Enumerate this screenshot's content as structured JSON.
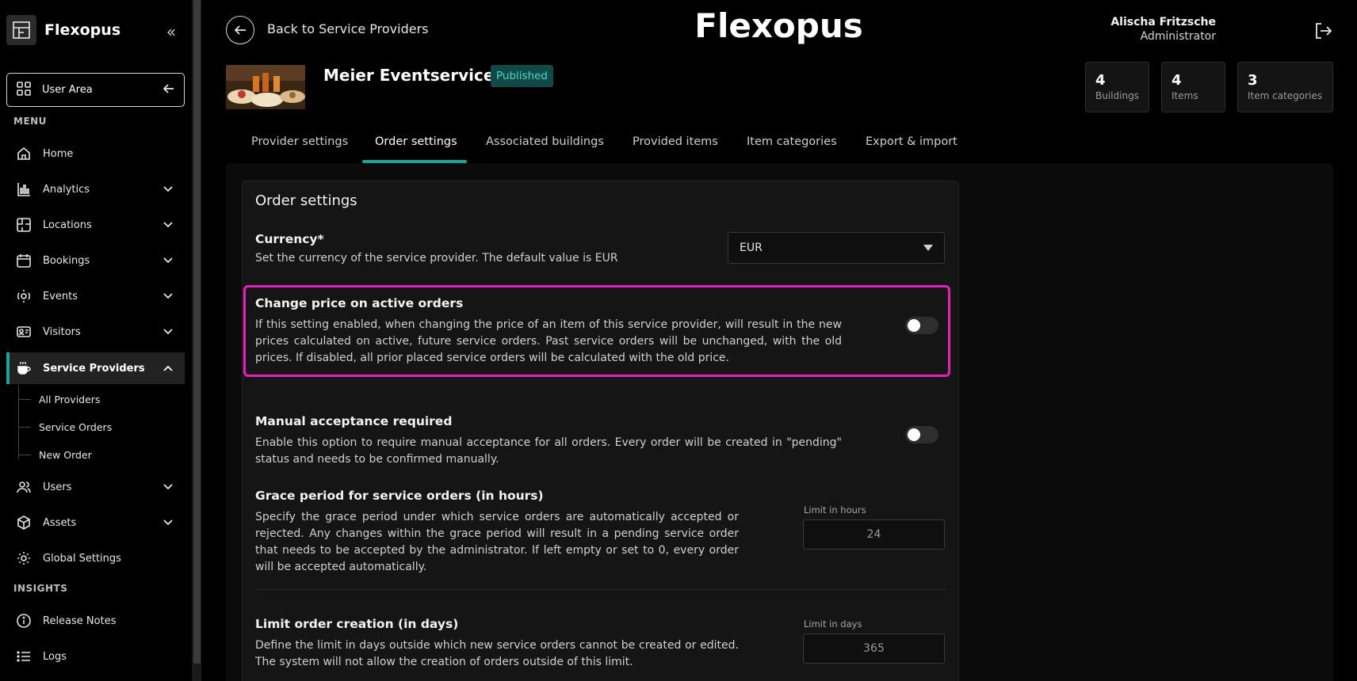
{
  "sidebar": {
    "brand": "Flexopus",
    "user_area": "User Area",
    "menu_label": "MENU",
    "insights_label": "INSIGHTS",
    "items": [
      {
        "label": "Home"
      },
      {
        "label": "Analytics"
      },
      {
        "label": "Locations"
      },
      {
        "label": "Bookings"
      },
      {
        "label": "Events"
      },
      {
        "label": "Visitors"
      },
      {
        "label": "Service Providers"
      },
      {
        "label": "Users"
      },
      {
        "label": "Assets"
      },
      {
        "label": "Global Settings"
      }
    ],
    "sub_items": [
      {
        "label": "All Providers"
      },
      {
        "label": "Service Orders"
      },
      {
        "label": "New Order"
      }
    ],
    "insights": [
      {
        "label": "Release Notes"
      },
      {
        "label": "Logs"
      }
    ]
  },
  "header": {
    "back_label": "Back to Service Providers",
    "title": "Flexopus",
    "user_name": "Alischa Fritzsche",
    "user_role": "Administrator"
  },
  "provider": {
    "name": "Meier Eventservice",
    "status": "Published",
    "stats": [
      {
        "value": "4",
        "label": "Buildings"
      },
      {
        "value": "4",
        "label": "Items"
      },
      {
        "value": "3",
        "label": "Item categories"
      }
    ]
  },
  "tabs": [
    {
      "label": "Provider settings"
    },
    {
      "label": "Order settings"
    },
    {
      "label": "Associated buildings"
    },
    {
      "label": "Provided items"
    },
    {
      "label": "Item categories"
    },
    {
      "label": "Export & import"
    }
  ],
  "order_settings": {
    "title": "Order settings",
    "currency": {
      "title": "Currency*",
      "desc": "Set the currency of the service provider. The default value is EUR",
      "value": "EUR"
    },
    "change_price": {
      "title": "Change price on active orders",
      "desc": "If this setting enabled, when changing the price of an item of this service provider, will result in the new prices calculated on active, future service orders. Past service orders will be unchanged, with the old prices. If disabled, all prior placed service orders will be calculated with the old price.",
      "enabled": false
    },
    "manual_acceptance": {
      "title": "Manual acceptance required",
      "desc": "Enable this option to require manual acceptance for all orders. Every order will be created in \"pending\" status and needs to be confirmed manually.",
      "enabled": false
    },
    "grace_period": {
      "title": "Grace period for service orders (in hours)",
      "desc": "Specify the grace period under which service orders are automatically accepted or rejected. Any changes within the grace period will result in a pending service order that needs to be accepted by the administrator. If left empty or set to 0, every order will be accepted automatically.",
      "field_label": "Limit in hours",
      "placeholder": "24"
    },
    "limit_creation": {
      "title": "Limit order creation (in days)",
      "desc": "Define the limit in days outside which new service orders cannot be created or edited. The system will not allow the creation of orders outside of this limit.",
      "field_label": "Limit in days",
      "placeholder": "365"
    }
  },
  "colors": {
    "accent": "#15a599",
    "highlight": "#e61ec0",
    "badge_bg": "#0f4a46",
    "badge_text": "#4fd6c8"
  }
}
